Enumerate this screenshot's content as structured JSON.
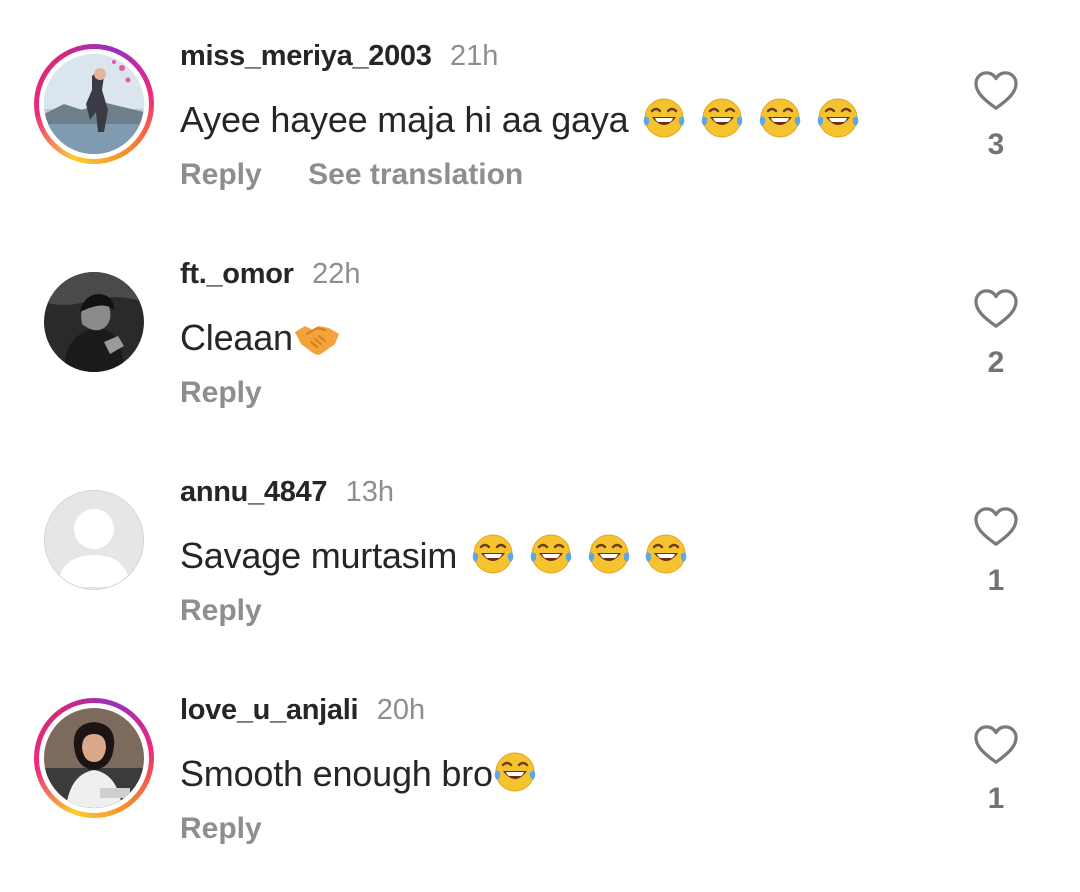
{
  "comments": [
    {
      "username": "miss_meriya_2003",
      "time": "21h",
      "text": "Ayee hayee maja hi aa gaya",
      "emoji": [
        "face-with-tears-of-joy",
        "face-with-tears-of-joy",
        "face-with-tears-of-joy",
        "face-with-tears-of-joy"
      ],
      "actions": [
        "Reply",
        "See translation"
      ],
      "likes": "3",
      "has_story_ring": true
    },
    {
      "username": "ft._omor",
      "time": "22h",
      "text": "Cleaan",
      "emoji": [
        "handshake"
      ],
      "actions": [
        "Reply"
      ],
      "likes": "2",
      "has_story_ring": false
    },
    {
      "username": "annu_4847",
      "time": "13h",
      "text": "Savage murtasim",
      "emoji": [
        "face-with-tears-of-joy",
        "face-with-tears-of-joy",
        "face-with-tears-of-joy",
        "face-with-tears-of-joy"
      ],
      "actions": [
        "Reply"
      ],
      "likes": "1",
      "has_story_ring": false
    },
    {
      "username": "love_u_anjali",
      "time": "20h",
      "text": "Smooth enough bro",
      "emoji": [
        "face-with-tears-of-joy"
      ],
      "actions": [
        "Reply"
      ],
      "likes": "1",
      "has_story_ring": true
    }
  ],
  "icons": {
    "like": "heart-outline-icon"
  },
  "colors": {
    "text": "#262626",
    "secondary": "#8e8e8e",
    "count": "#737373",
    "ring_start": "#f9ce34",
    "ring_mid": "#ee2a7b",
    "ring_end": "#962fbf"
  }
}
